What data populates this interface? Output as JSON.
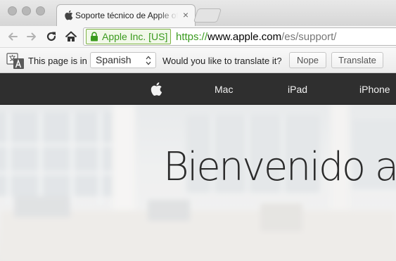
{
  "browser": {
    "tab": {
      "title": "Soporte técnico de Apple oficial",
      "favicon": "apple-icon",
      "close_glyph": "×"
    },
    "toolbar": {
      "back_icon": "back-arrow-icon",
      "forward_icon": "forward-arrow-icon",
      "reload_icon": "reload-icon",
      "home_icon": "home-icon"
    },
    "omnibox": {
      "ev_org": "Apple Inc. [US]",
      "url_scheme": "https://",
      "url_host": "www.apple.com",
      "url_path": "/es/support/",
      "secure_color": "#3a9a1e"
    }
  },
  "translate_bar": {
    "prefix": "This page is in",
    "language": "Spanish",
    "question": "Would you like to translate it?",
    "nope_label": "Nope",
    "translate_label": "Translate"
  },
  "site": {
    "nav": {
      "logo": "apple-logo-icon",
      "items": [
        "Mac",
        "iPad",
        "iPhone"
      ],
      "bg_color": "#2f2f2f"
    },
    "hero": {
      "title": "Bienvenido al"
    }
  }
}
